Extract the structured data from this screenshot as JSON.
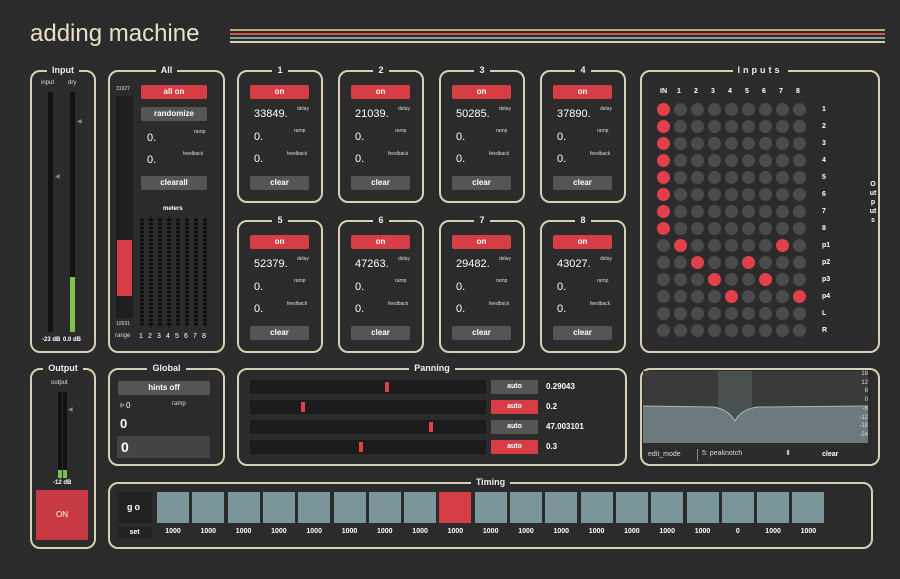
{
  "app": {
    "title": "adding machine"
  },
  "input": {
    "title": "Input",
    "ch1": "input",
    "ch2": "dry",
    "db1": "-23 dB",
    "db2": "0.0 dB"
  },
  "output": {
    "title": "Output",
    "label": "output",
    "db": "-12 dB",
    "on_label": "ON"
  },
  "all": {
    "title": "All",
    "all_on": "all on",
    "randomize": "randomize",
    "ramp_val": "0.",
    "ramp_label": "ramp",
    "feedback_val": "0.",
    "feedback_label": "feedback",
    "clearall": "clearall",
    "meters_label": "meters",
    "range_top": "31927",
    "range_bottom": "10931",
    "range_label": "range",
    "meter_labels": [
      "1",
      "2",
      "3",
      "4",
      "5",
      "6",
      "7",
      "8"
    ]
  },
  "delays": [
    {
      "title": "1",
      "on": "on",
      "delay": "33849.",
      "ramp": "0.",
      "feedback": "0.",
      "clear": "clear"
    },
    {
      "title": "2",
      "on": "on",
      "delay": "21039.",
      "ramp": "0.",
      "feedback": "0.",
      "clear": "clear"
    },
    {
      "title": "3",
      "on": "on",
      "delay": "50285.",
      "ramp": "0.",
      "feedback": "0.",
      "clear": "clear"
    },
    {
      "title": "4",
      "on": "on",
      "delay": "37890.",
      "ramp": "0.",
      "feedback": "0.",
      "clear": "clear"
    },
    {
      "title": "5",
      "on": "on",
      "delay": "52379.",
      "ramp": "0.",
      "feedback": "0.",
      "clear": "clear"
    },
    {
      "title": "6",
      "on": "on",
      "delay": "47263.",
      "ramp": "0.",
      "feedback": "0.",
      "clear": "clear"
    },
    {
      "title": "7",
      "on": "on",
      "delay": "29482.",
      "ramp": "0.",
      "feedback": "0.",
      "clear": "clear"
    },
    {
      "title": "8",
      "on": "on",
      "delay": "43027.",
      "ramp": "0.",
      "feedback": "0.",
      "clear": "clear"
    }
  ],
  "delay_labels": {
    "delay": "delay",
    "ramp": "ramp",
    "feedback": "feedback"
  },
  "inputs": {
    "title": "Inputs",
    "side_title": "Outputs",
    "cols": [
      "IN",
      "1",
      "2",
      "3",
      "4",
      "5",
      "6",
      "7",
      "8"
    ],
    "rows": [
      "1",
      "2",
      "3",
      "4",
      "5",
      "6",
      "7",
      "8",
      "p1",
      "p2",
      "p3",
      "p4",
      "L",
      "R"
    ],
    "active": [
      [
        0
      ],
      [
        0
      ],
      [
        0
      ],
      [
        0
      ],
      [
        0
      ],
      [
        0
      ],
      [
        0
      ],
      [
        0
      ],
      [
        1,
        7
      ],
      [
        2,
        5
      ],
      [
        3,
        6
      ],
      [
        4,
        8
      ],
      [],
      []
    ]
  },
  "global": {
    "title": "Global",
    "hints": "hints off",
    "ramp_val": "0",
    "ramp_label": "ramp",
    "val1": "0",
    "val2": "0"
  },
  "panning": {
    "title": "Panning",
    "rows": [
      {
        "auto": "auto",
        "auto_on": false,
        "value": "0.29043",
        "pos": 0.58
      },
      {
        "auto": "auto",
        "auto_on": true,
        "value": "0.2",
        "pos": 0.22
      },
      {
        "auto": "auto",
        "auto_on": false,
        "value": "47.003101",
        "pos": 0.77
      },
      {
        "auto": "auto",
        "auto_on": true,
        "value": "0.3",
        "pos": 0.47
      }
    ]
  },
  "filter": {
    "edit_mode": "edit_mode",
    "mode": "5: peaknotch",
    "clear": "clear",
    "scale": [
      "18",
      "12",
      "6",
      "0",
      "-6",
      "-12",
      "-18",
      "-24"
    ]
  },
  "timing": {
    "title": "Timing",
    "go": "go",
    "set": "set",
    "active_step": 8,
    "values": [
      "1000",
      "1000",
      "1000",
      "1000",
      "1000",
      "1000",
      "1000",
      "1000",
      "1000",
      "1000",
      "1000",
      "1000",
      "1000",
      "1000",
      "1000",
      "1000",
      "0",
      "1000",
      "1000"
    ]
  },
  "colors": {
    "accent": "#d63d45",
    "panel_border": "#d8cfb4",
    "step": "#7b969a"
  }
}
